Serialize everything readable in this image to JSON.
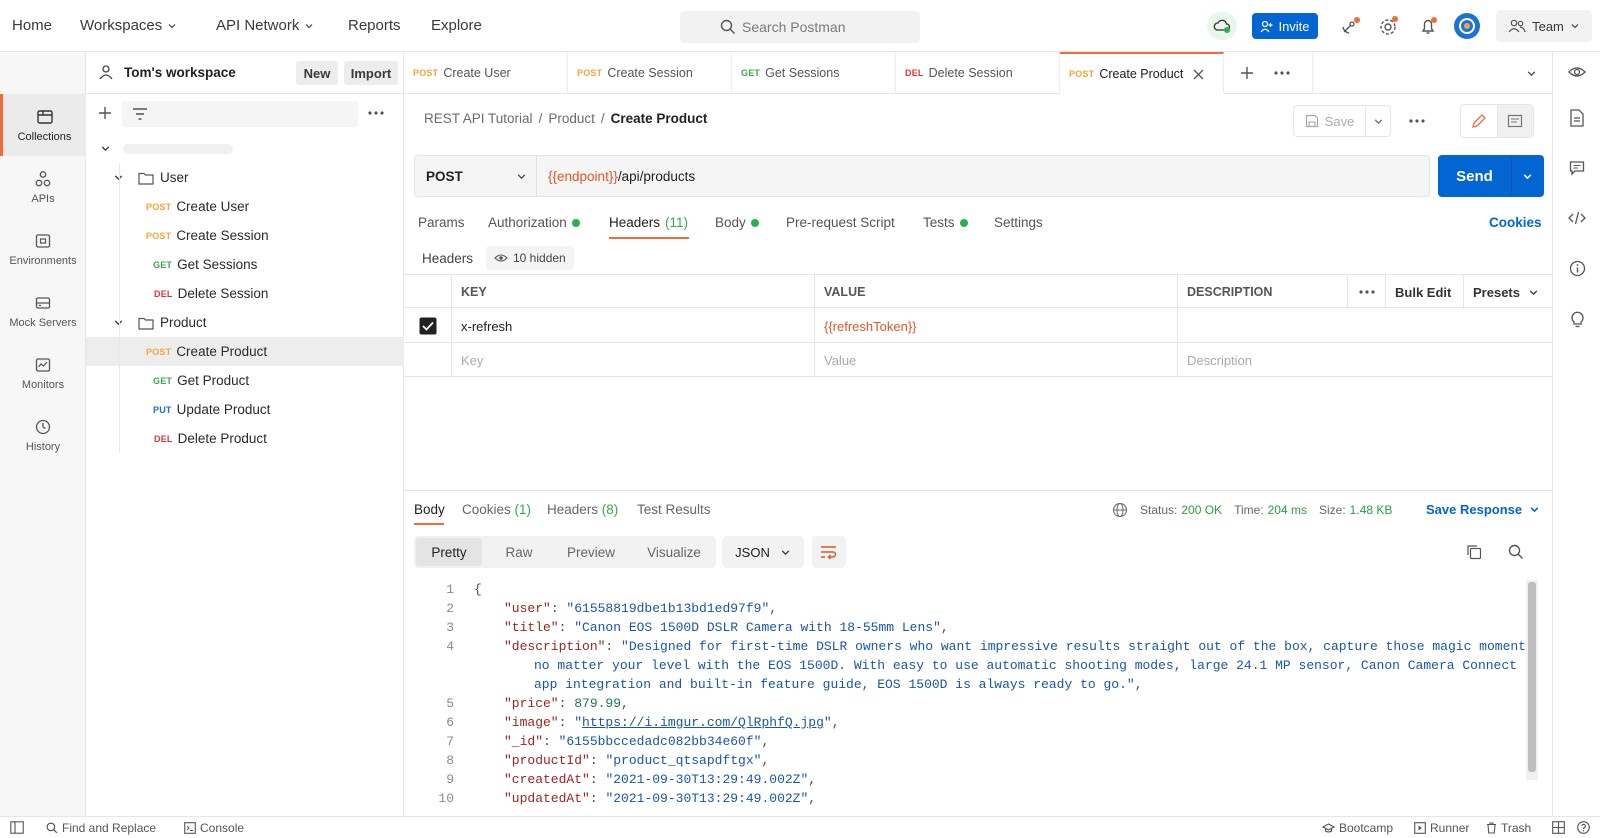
{
  "nav": {
    "home": "Home",
    "workspaces": "Workspaces",
    "api_network": "API Network",
    "reports": "Reports",
    "explore": "Explore",
    "search_placeholder": "Search Postman",
    "invite": "Invite",
    "team": "Team"
  },
  "rail": {
    "collections": "Collections",
    "apis": "APIs",
    "environments": "Environments",
    "mock_servers": "Mock Servers",
    "monitors": "Monitors",
    "history": "History"
  },
  "workspace": {
    "name": "Tom's workspace",
    "new": "New",
    "import": "Import"
  },
  "tree": {
    "folder_user": "User",
    "folder_product": "Product",
    "items": [
      {
        "method": "POST",
        "label": "Create User"
      },
      {
        "method": "POST",
        "label": "Create Session"
      },
      {
        "method": "GET",
        "label": "Get Sessions"
      },
      {
        "method": "DEL",
        "label": "Delete Session"
      },
      {
        "method": "POST",
        "label": "Create Product"
      },
      {
        "method": "GET",
        "label": "Get Product"
      },
      {
        "method": "PUT",
        "label": "Update Product"
      },
      {
        "method": "DEL",
        "label": "Delete Product"
      }
    ]
  },
  "tabs": [
    {
      "method": "POST",
      "label": "Create User"
    },
    {
      "method": "POST",
      "label": "Create Session"
    },
    {
      "method": "GET",
      "label": "Get Sessions"
    },
    {
      "method": "DEL",
      "label": "Delete Session"
    },
    {
      "method": "POST",
      "label": "Create Product"
    }
  ],
  "breadcrumb": {
    "root": "REST API Tutorial",
    "sep": "/",
    "folder": "Product",
    "current": "Create Product"
  },
  "toolbar": {
    "save": "Save"
  },
  "request": {
    "method": "POST",
    "url_var": "{{endpoint}}",
    "url_path": "/api/products",
    "send": "Send",
    "cookies": "Cookies"
  },
  "req_tabs": {
    "params": "Params",
    "authorization": "Authorization",
    "headers": "Headers",
    "headers_count": "(11)",
    "body": "Body",
    "prerequest": "Pre-request Script",
    "tests": "Tests",
    "settings": "Settings"
  },
  "headers_section": {
    "title": "Headers",
    "hidden": "10 hidden",
    "col_key": "KEY",
    "col_value": "VALUE",
    "col_description": "DESCRIPTION",
    "bulk_edit": "Bulk Edit",
    "presets": "Presets",
    "row_key": "x-refresh",
    "row_value": "{{refreshToken}}",
    "ph_key": "Key",
    "ph_value": "Value",
    "ph_description": "Description"
  },
  "response": {
    "body": "Body",
    "cookies": "Cookies",
    "cookies_count": "(1)",
    "headers": "Headers",
    "headers_count": "(8)",
    "test_results": "Test Results",
    "status_label": "Status:",
    "status": "200 OK",
    "time_label": "Time:",
    "time": "204 ms",
    "size_label": "Size:",
    "size": "1.48 KB",
    "save_response": "Save Response",
    "pretty": "Pretty",
    "raw": "Raw",
    "preview": "Preview",
    "visualize": "Visualize",
    "format": "JSON"
  },
  "code": {
    "open": "{",
    "k_user": "\"user\"",
    "v_user": "\"61558819dbe1b13bd1ed97f9\"",
    "k_title": "\"title\"",
    "v_title": "\"Canon EOS 1500D DSLR Camera with 18-55mm Lens\"",
    "k_desc": "\"description\"",
    "v_desc_1": "\"Designed for first-time DSLR owners who want impressive results straight out of the box, capture those magic moments",
    "v_desc_2": "no matter your level with the EOS 1500D. With easy to use automatic shooting modes, large 24.1 MP sensor, Canon Camera Connect",
    "v_desc_3": "app integration and built-in feature guide, EOS 1500D is always ready to go.\"",
    "k_price": "\"price\"",
    "v_price": "879.99",
    "k_image": "\"image\"",
    "v_image": "https://i.imgur.com/QlRphfQ.jpg",
    "k_id": "\"_id\"",
    "v_id": "\"6155bbccedadc082bb34e60f\"",
    "k_pid": "\"productId\"",
    "v_pid": "\"product_qtsapdftgx\"",
    "k_created": "\"createdAt\"",
    "v_created": "\"2021-09-30T13:29:49.002Z\"",
    "k_updated": "\"updatedAt\"",
    "v_updated": "\"2021-09-30T13:29:49.002Z\""
  },
  "statusbar": {
    "find_replace": "Find and Replace",
    "console": "Console",
    "bootcamp": "Bootcamp",
    "runner": "Runner",
    "trash": "Trash"
  },
  "colors": {
    "accent": "#f26b3a",
    "primary": "#0265d2",
    "post": "#f3a43b",
    "get": "#38a852",
    "put": "#1d72d6",
    "del": "#d83a3a",
    "ok": "#26b24b"
  }
}
